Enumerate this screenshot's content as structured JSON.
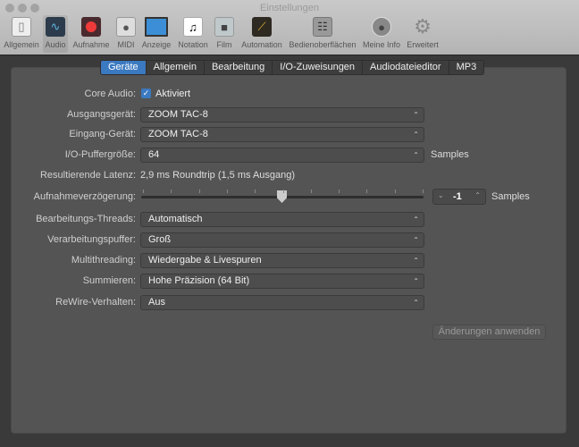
{
  "window": {
    "title": "Einstellungen"
  },
  "toolbar": [
    {
      "label": "Allgemein",
      "icon": "switch-icon"
    },
    {
      "label": "Audio",
      "icon": "waveform-icon"
    },
    {
      "label": "Aufnahme",
      "icon": "record-icon"
    },
    {
      "label": "MIDI",
      "icon": "midi-icon"
    },
    {
      "label": "Anzeige",
      "icon": "display-icon"
    },
    {
      "label": "Notation",
      "icon": "note-icon"
    },
    {
      "label": "Film",
      "icon": "camera-icon"
    },
    {
      "label": "Automation",
      "icon": "automation-icon"
    },
    {
      "label": "Bedienoberflächen",
      "icon": "faders-icon"
    },
    {
      "label": "Meine Info",
      "icon": "user-icon"
    },
    {
      "label": "Erweitert",
      "icon": "gear-icon"
    }
  ],
  "tabs": [
    "Geräte",
    "Allgemein",
    "Bearbeitung",
    "I/O-Zuweisungen",
    "Audiodateieditor",
    "MP3"
  ],
  "form": {
    "core_audio_label": "Core Audio:",
    "core_audio_value": "Aktiviert",
    "ausgang_label": "Ausgangsgerät:",
    "ausgang_value": "ZOOM TAC-8",
    "eingang_label": "Eingang-Gerät:",
    "eingang_value": "ZOOM TAC-8",
    "puffer_label": "I/O-Puffergröße:",
    "puffer_value": "64",
    "puffer_unit": "Samples",
    "latenz_label": "Resultierende Latenz:",
    "latenz_value": "2,9 ms Roundtrip (1,5 ms Ausgang)",
    "verz_label": "Aufnahmeverzögerung:",
    "verz_value": "-1",
    "verz_unit": "Samples",
    "threads_label": "Bearbeitungs-Threads:",
    "threads_value": "Automatisch",
    "vpuffer_label": "Verarbeitungspuffer:",
    "vpuffer_value": "Groß",
    "multi_label": "Multithreading:",
    "multi_value": "Wiedergabe & Livespuren",
    "summ_label": "Summieren:",
    "summ_value": "Hohe Präzision (64 Bit)",
    "rewire_label": "ReWire-Verhalten:",
    "rewire_value": "Aus"
  },
  "apply_button": "Änderungen anwenden"
}
